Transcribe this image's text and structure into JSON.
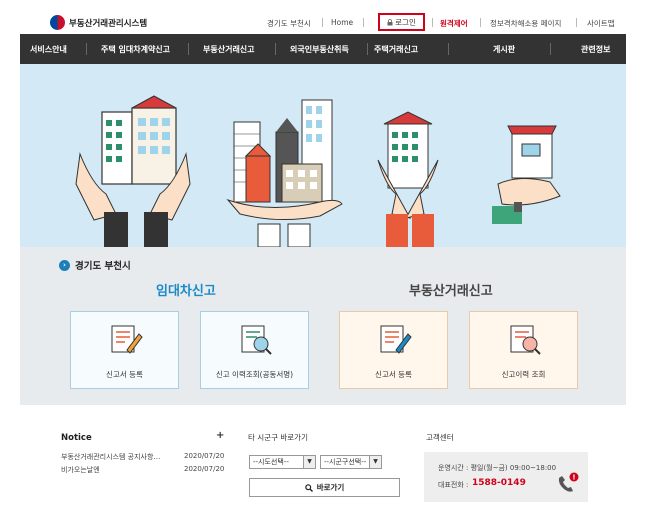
{
  "header": {
    "logo_text": "부동산거래관리시스템",
    "region_link": "경기도 부천시",
    "home": "Home",
    "login": "로그인",
    "remote": "원격제어",
    "privacy": "정보격차해소용 페이지",
    "sitemap": "사이트맵"
  },
  "nav": {
    "items": [
      {
        "label": "서비스안내"
      },
      {
        "label": "주택 임대차계약신고"
      },
      {
        "label": "부동산거래신고"
      },
      {
        "label": "외국인부동산취득"
      },
      {
        "label": "주택거래신고"
      },
      {
        "label": "게시판"
      },
      {
        "label": "관련정보"
      }
    ]
  },
  "panel": {
    "region": "경기도 부천시",
    "lease_title": "임대차신고",
    "trade_title": "부동산거래신고",
    "cards": [
      {
        "label": "신고서 등록"
      },
      {
        "label": "신고 이력조회(공동서명)"
      },
      {
        "label": "신고서 등록"
      },
      {
        "label": "신고이력 조회"
      }
    ]
  },
  "notice": {
    "title": "Notice",
    "more": "+",
    "rows": [
      {
        "title": "부동산거래관리시스템 공지사항…",
        "date": "2020/07/20"
      },
      {
        "title": "비가오는날엔",
        "date": "2020/07/20"
      }
    ]
  },
  "other": {
    "title": "타 시군구 바로가기",
    "sido": "--시도선택--",
    "sigungu": "--시군구선택--",
    "go": "바로가기"
  },
  "cs": {
    "title": "고객센터",
    "hours": "운영시간 : 평일(월~금) 09:00~18:00",
    "phone_label": "대표전화 :",
    "phone": "1588-0149"
  },
  "colors": {
    "nav_bg": "#333333",
    "hero_bg": "#d3eaf6",
    "accent_blue": "#1a8ac8",
    "accent_red": "#d0021b"
  }
}
